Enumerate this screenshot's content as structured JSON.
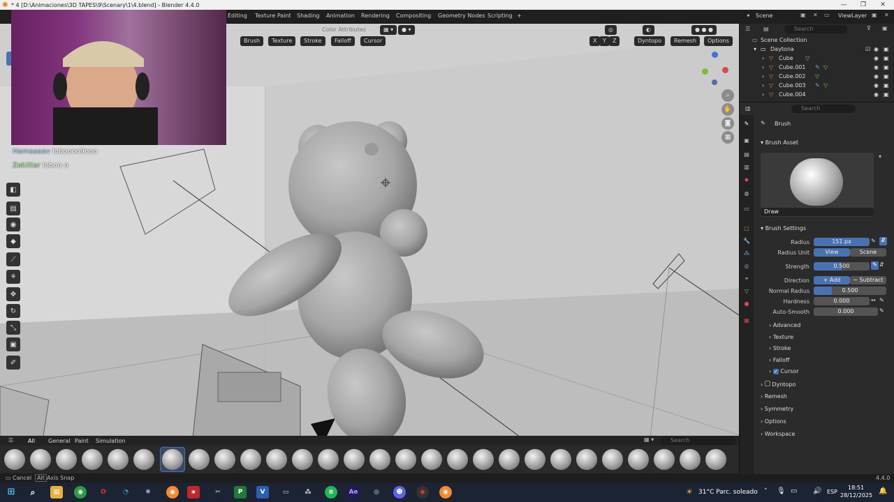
{
  "window": {
    "title": "* 4 [D:\\Animaciones\\3D TAPES\\9\\Scenary\\1\\4.blend] - Blender 4.4.0",
    "controls": [
      "—",
      "❐",
      "✕"
    ]
  },
  "workspace_tabs": [
    "Editing",
    "Texture Paint",
    "Shading",
    "Animation",
    "Rendering",
    "Compositing",
    "Geometry Nodes",
    "Scripting",
    "+"
  ],
  "viewport_header": {
    "color_attributes": "Color Attributes",
    "menus": [
      "Brush",
      "Texture",
      "Stroke",
      "Falloff",
      "Cursor"
    ],
    "symmetry_axes": [
      "X",
      "Y",
      "Z"
    ],
    "dyntopo": "Dyntopo",
    "remesh": "Remesh",
    "options": "Options"
  },
  "webcam_overlay": {
    "chat": [
      {
        "user": "Hamaaaav",
        "message": "loboooo9ooo"
      },
      {
        "user": "ZakXtar",
        "message": "loboo o"
      }
    ]
  },
  "right_header": {
    "scene": "Scene",
    "view_layer": "ViewLayer"
  },
  "outliner": {
    "search_placeholder": "Search",
    "root": "Scene Collection",
    "collection": "Daytona",
    "items": [
      "Cube",
      "Cube.001",
      "Cube.002",
      "Cube.003",
      "Cube.004"
    ]
  },
  "properties": {
    "search_placeholder": "Search",
    "tool_name": "Brush",
    "brush_asset_panel": "Brush Asset",
    "brush_name": "Draw",
    "brush_settings_panel": "Brush Settings",
    "radius_label": "Radius",
    "radius_value": "151 px",
    "radius_unit_label": "Radius Unit",
    "radius_unit_options": [
      "View",
      "Scene"
    ],
    "strength_label": "Strength",
    "strength_value": "0.500",
    "direction_label": "Direction",
    "direction_options": [
      "Add",
      "Subtract"
    ],
    "normal_radius_label": "Normal Radius",
    "normal_radius_value": "0.500",
    "hardness_label": "Hardness",
    "hardness_value": "0.000",
    "auto_smooth_label": "Auto-Smooth",
    "auto_smooth_value": "0.000",
    "subpanels": [
      "Advanced",
      "Texture",
      "Stroke",
      "Falloff",
      "Cursor"
    ],
    "panels": [
      "Dyntopo",
      "Remesh",
      "Symmetry",
      "Options",
      "Workspace"
    ]
  },
  "asset_shelf": {
    "tabs": [
      "All",
      "General",
      "Paint",
      "Simulation"
    ],
    "search_placeholder": "Search"
  },
  "status_bar": {
    "left": [
      "Cancel",
      "Alt",
      "Axis Snap"
    ],
    "version": "4.4.0"
  },
  "taskbar": {
    "weather": "31°C  Parc. soleado",
    "language": "ESP",
    "time": "18:51",
    "date": "28/12/2025"
  },
  "colors": {
    "accent": "#4772b3",
    "viewport_bg": "#cfcfcf",
    "panel_bg": "#2b2b2b"
  }
}
